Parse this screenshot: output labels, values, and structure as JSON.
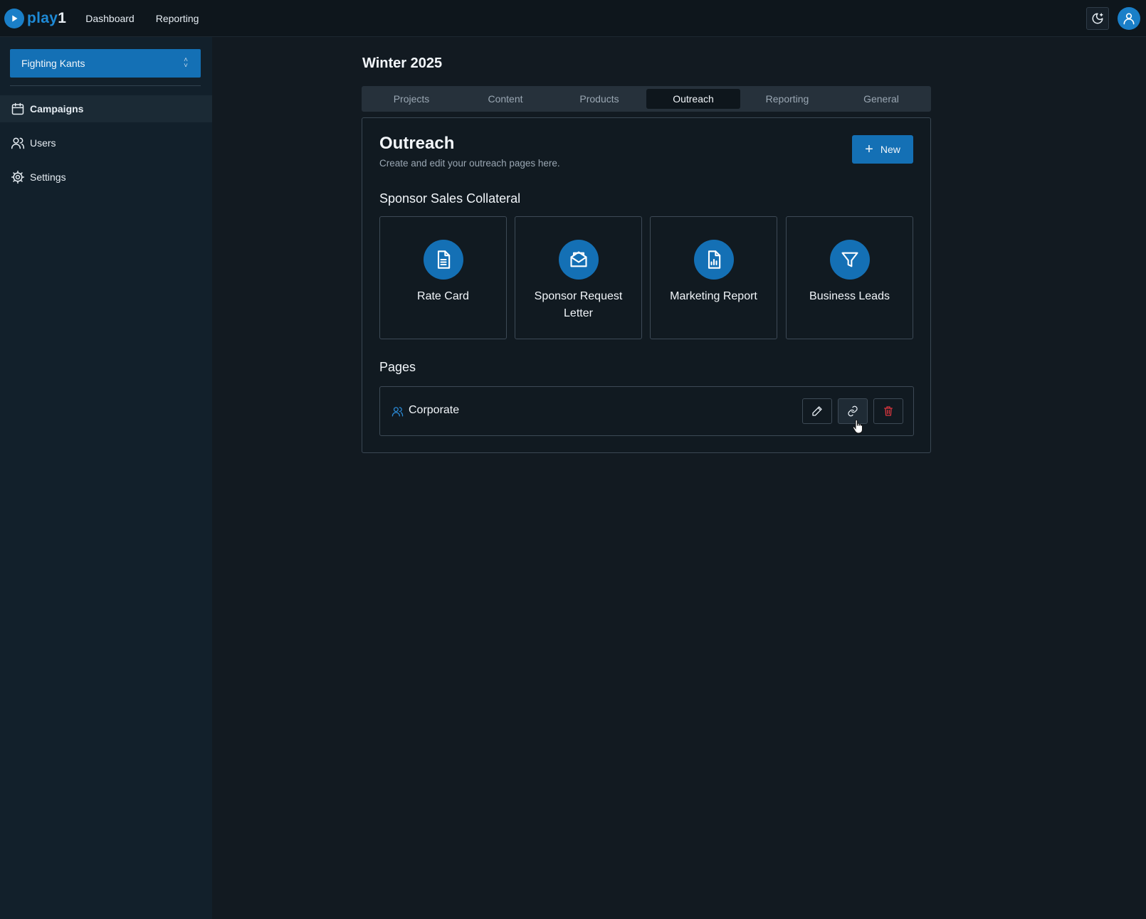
{
  "topbar": {
    "logo_text": "play",
    "logo_num": "1",
    "nav": [
      "Dashboard",
      "Reporting"
    ],
    "theme_icon": "moon-stars-icon",
    "avatar_icon": "user-icon"
  },
  "sidebar": {
    "team": "Fighting Kants",
    "items": [
      {
        "label": "Campaigns",
        "icon": "calendar-icon",
        "active": true
      },
      {
        "label": "Users",
        "icon": "users-icon",
        "active": false
      },
      {
        "label": "Settings",
        "icon": "gear-icon",
        "active": false
      }
    ]
  },
  "main": {
    "season_title": "Winter 2025",
    "tabs": [
      {
        "label": "Projects",
        "active": false
      },
      {
        "label": "Content",
        "active": false
      },
      {
        "label": "Products",
        "active": false
      },
      {
        "label": "Outreach",
        "active": true
      },
      {
        "label": "Reporting",
        "active": false
      },
      {
        "label": "General",
        "active": false
      }
    ],
    "panel": {
      "title": "Outreach",
      "subtitle": "Create and edit your outreach pages here.",
      "new_button": "New",
      "collateral_title": "Sponsor Sales Collateral",
      "cards": [
        {
          "label": "Rate Card",
          "icon": "document-icon"
        },
        {
          "label": "Sponsor Request Letter",
          "icon": "envelope-icon"
        },
        {
          "label": "Marketing Report",
          "icon": "chart-file-icon"
        },
        {
          "label": "Business Leads",
          "icon": "filter-icon"
        }
      ],
      "pages_title": "Pages",
      "pages": [
        {
          "name": "Corporate",
          "icon": "users-icon"
        }
      ]
    }
  },
  "colors": {
    "accent": "#1470b5",
    "background": "#121a21",
    "sidebar": "#12202b",
    "danger": "#d9363e"
  }
}
